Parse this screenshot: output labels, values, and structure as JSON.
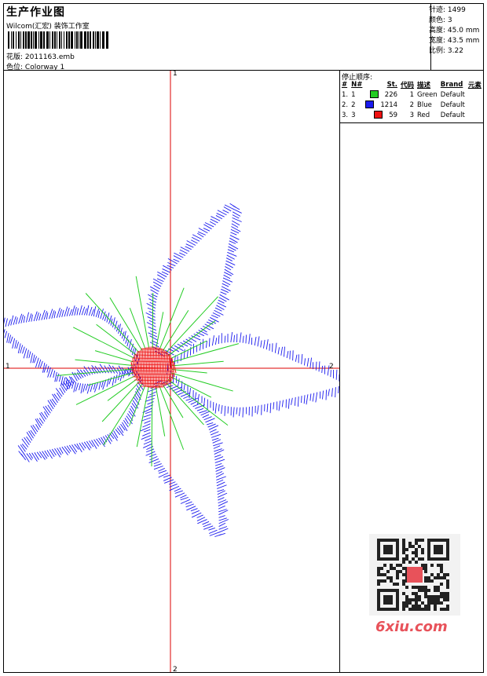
{
  "header": {
    "title": "生产作业图",
    "studio": "Wilcom(汇宏) 装饰工作室",
    "design_label": "花版:",
    "design_value": "2011163.emb",
    "colorway_label": "色位:",
    "colorway_value": "Colorway 1"
  },
  "stats": [
    {
      "label": "针迹:",
      "value": "1499"
    },
    {
      "label": "颜色:",
      "value": "3"
    },
    {
      "label": "高度:",
      "value": "45.0 mm"
    },
    {
      "label": "宽度:",
      "value": "43.5 mm"
    },
    {
      "label": "比例:",
      "value": "3.22"
    }
  ],
  "stop_sequence": {
    "title": "停止顺序:",
    "columns": [
      "#",
      "N#",
      "St.",
      "代码",
      "描述",
      "Brand",
      "元素"
    ],
    "rows": [
      {
        "idx": "1.",
        "n": "1",
        "color": "#22cc22",
        "st": "226",
        "code": "1",
        "desc": "Green",
        "brand": "Default"
      },
      {
        "idx": "2.",
        "n": "2",
        "color": "#1a1aee",
        "st": "1214",
        "code": "2",
        "desc": "Blue",
        "brand": "Default"
      },
      {
        "idx": "3.",
        "n": "3",
        "color": "#ee1111",
        "st": "59",
        "code": "3",
        "desc": "Red",
        "brand": "Default"
      }
    ]
  },
  "axes": {
    "top": "1",
    "bottom": "2",
    "left": "1",
    "right": "2"
  },
  "colors": {
    "petal_outline": "#1a1aee",
    "center_rays": "#22cc22",
    "center_satin": "#ee1111",
    "crosshair": "#dd0000"
  },
  "watermark": "6xiu.com"
}
